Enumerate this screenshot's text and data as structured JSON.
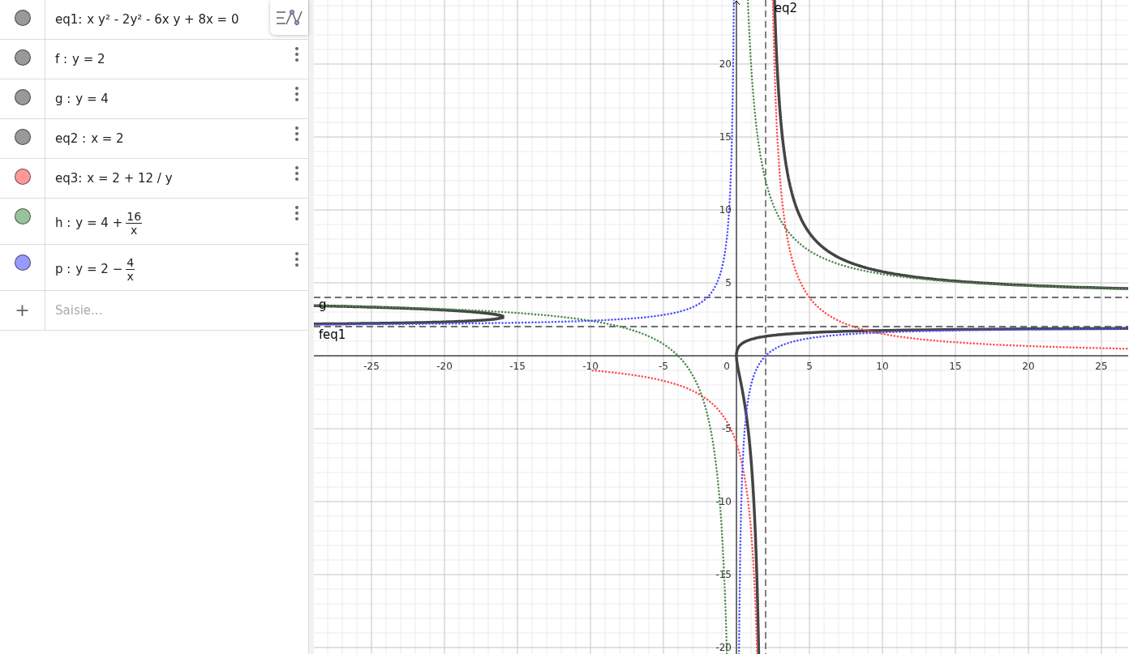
{
  "algebra_view": {
    "items": [
      {
        "label": "eq1:",
        "expression": "x y² - 2y² - 6x y + 8x = 0",
        "color": "#999999",
        "kind": "style"
      },
      {
        "label": "f :",
        "expression": "y = 2",
        "color": "#999999",
        "kind": "kebab"
      },
      {
        "label": "g :",
        "expression": "y = 4",
        "color": "#999999",
        "kind": "kebab"
      },
      {
        "label": "eq2 :",
        "expression": "x = 2",
        "color": "#999999",
        "kind": "kebab"
      },
      {
        "label": "eq3:",
        "expression": "x = 2 + 12 / y",
        "color": "#ff9999",
        "kind": "kebab"
      },
      {
        "label": "h :",
        "expression": "y = 4 +",
        "fraction": {
          "numerator": "16",
          "denominator": "x"
        },
        "color": "#99c299",
        "kind": "kebab"
      },
      {
        "label": "p :",
        "expression": "y = 2 −",
        "fraction": {
          "numerator": "4",
          "denominator": "x"
        },
        "color": "#9999ff",
        "kind": "kebab"
      }
    ],
    "input": {
      "icon": "+",
      "placeholder": "Saisie..."
    }
  },
  "graphics_view": {
    "x_ticks": [
      "-25",
      "-20",
      "-15",
      "-10",
      "-5",
      "0",
      "5",
      "10",
      "15",
      "20",
      "25"
    ],
    "y_ticks": [
      "20",
      "15",
      "10",
      "5",
      "-5",
      "-10",
      "-15",
      "-20"
    ],
    "curve_labels": [
      "eq2",
      "g",
      "f",
      "eq1"
    ]
  }
}
